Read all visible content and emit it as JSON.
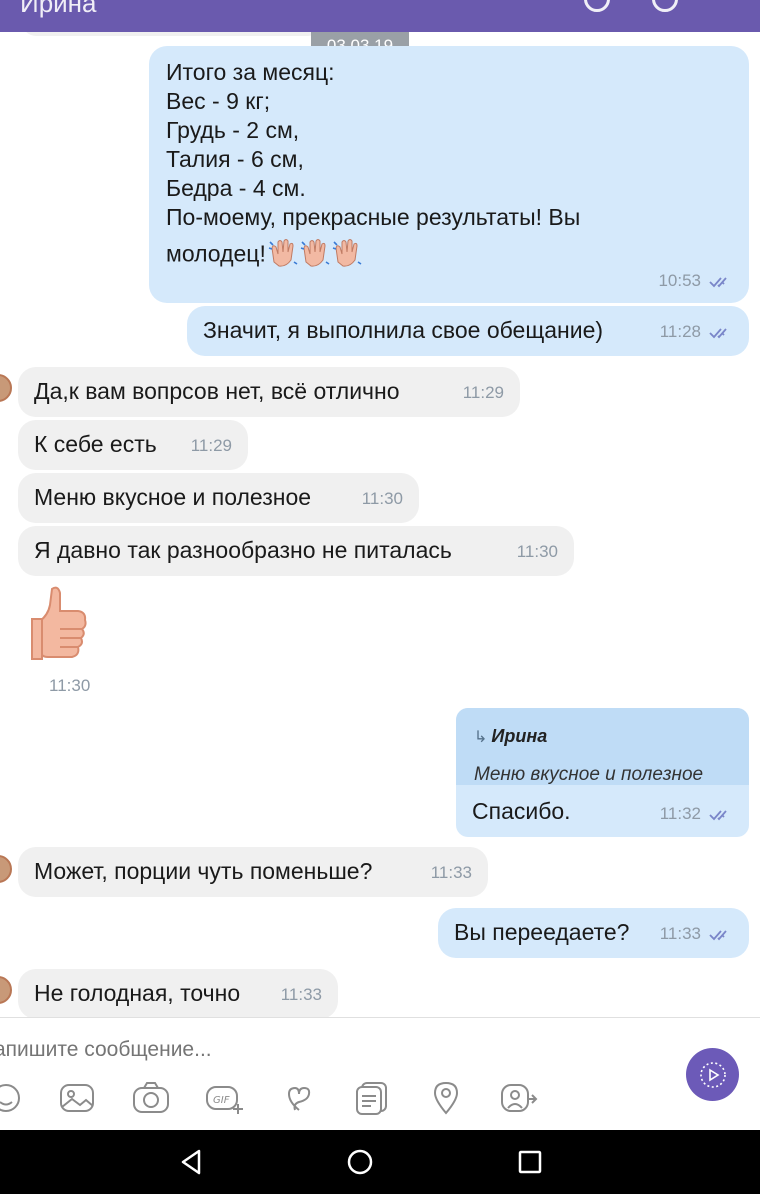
{
  "header": {
    "title_fragment": "Ирина"
  },
  "chat": {
    "date_separator": "03.03.19",
    "messages": [
      {
        "id": "m1",
        "side": "out",
        "lines": [
          "Итого за месяц:",
          "Вес - 9 кг;",
          "Грудь - 2 см,",
          "Талия - 6 см,",
          "Бедра - 4 см.",
          "По-моему, прекрасные результаты! Вы",
          "молодец!"
        ],
        "emoji": "waving-hands-icon",
        "time": "10:53",
        "read": true
      },
      {
        "id": "m2",
        "side": "out",
        "text": "Значит, я выполнила свое обещание)",
        "time": "11:28",
        "read": true
      },
      {
        "id": "m3",
        "side": "in",
        "text": "Да,к вам вопрсов нет, всё отлично",
        "time": "11:29"
      },
      {
        "id": "m4",
        "side": "in",
        "text": "К себе есть",
        "time": "11:29"
      },
      {
        "id": "m5",
        "side": "in",
        "text": "Меню вкусное и полезное",
        "time": "11:30"
      },
      {
        "id": "m6",
        "side": "in",
        "text": "Я давно так разнообразно не питалась",
        "time": "11:30"
      },
      {
        "id": "m7",
        "side": "in",
        "sticker": "thumbs-up-icon",
        "time": "11:30"
      },
      {
        "id": "m8",
        "side": "out",
        "reply": {
          "name": "Ирина",
          "quote": "Меню вкусное и полезное"
        },
        "text": "Спасибо.",
        "time": "11:32",
        "read": true
      },
      {
        "id": "m9",
        "side": "in",
        "text": "Может, порции чуть поменьше?",
        "time": "11:33"
      },
      {
        "id": "m10",
        "side": "out",
        "text": "Вы переедаете?",
        "time": "11:33",
        "read": true
      },
      {
        "id": "m11",
        "side": "in",
        "text": "Не голодная, точно",
        "time": "11:33"
      }
    ]
  },
  "composer": {
    "placeholder": "апишите сообщение...",
    "send_icon": "send-video-icon",
    "toolbar": [
      "sticker-icon",
      "gallery-icon",
      "camera-icon",
      "gif-icon",
      "doodle-icon",
      "file-icon",
      "location-icon",
      "more-share-icon"
    ]
  },
  "colors": {
    "header": "#6a5aae",
    "outgoing_bubble": "#d5e9fb",
    "incoming_bubble": "#f0f0f0",
    "reply_header": "#bfdcf6",
    "accent": "#6c5ab8",
    "read_ticks": "#7a86c9"
  },
  "system_nav": [
    "back-icon",
    "home-icon",
    "recents-icon"
  ]
}
